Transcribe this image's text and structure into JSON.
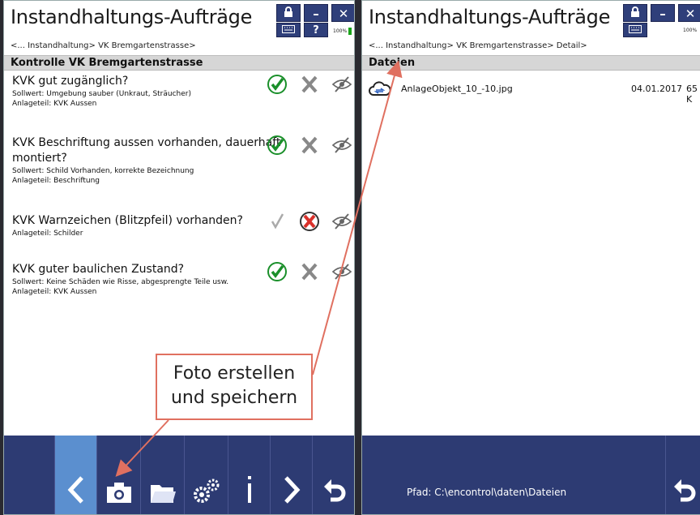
{
  "left": {
    "title": "Instandhaltungs-Aufträge",
    "breadcrumb": "<... Instandhaltung>  VK Bremgartenstrasse>",
    "section": "Kontrolle VK Bremgartenstrasse",
    "battery": "100%",
    "help_label": "?",
    "items": [
      {
        "question": "KVK gut zugänglich?",
        "sollwert": "Sollwert: Umgebung sauber (Unkraut, Sträucher)",
        "anlageteil": "Anlageteil: KVK Aussen",
        "state": "ok"
      },
      {
        "question": "KVK Beschriftung aussen vorhanden, dauerhaft",
        "question2": "montiert?",
        "sollwert": "Sollwert: Schild Vorhanden, korrekte Bezeichnung",
        "anlageteil": "Anlageteil: Beschriftung",
        "state": "ok"
      },
      {
        "question": "KVK Warnzeichen (Blitzpfeil) vorhanden?",
        "anlageteil": "Anlageteil: Schilder",
        "state": "fail"
      },
      {
        "question": "KVK guter baulichen Zustand?",
        "sollwert": "Sollwert: Keine Schäden wie Risse, abgesprengte Teile usw.",
        "anlageteil": "Anlageteil: KVK Aussen",
        "state": "ok"
      }
    ],
    "toolbar": [
      "back-icon",
      "camera-icon",
      "folder-icon",
      "gears-icon",
      "info-icon",
      "forward-icon",
      "undo-icon"
    ]
  },
  "right": {
    "title": "Instandhaltungs-Aufträge",
    "breadcrumb": "<... Instandhaltung>  VK Bremgartenstrasse>  Detail>",
    "section": "Dateien",
    "battery": "100%",
    "file": {
      "name": "AnlageObjekt_10_-10.jpg",
      "date": "04.01.2017",
      "size": "65 K"
    },
    "path": "Pfad: C:\\encontrol\\daten\\Dateien"
  },
  "callout": {
    "line1": "Foto erstellen",
    "line2": "und speichern"
  },
  "colors": {
    "toolbar": "#2d3b73",
    "active": "#5b8fcf",
    "check": "#1a8f2a",
    "callout_border": "#e07060"
  }
}
